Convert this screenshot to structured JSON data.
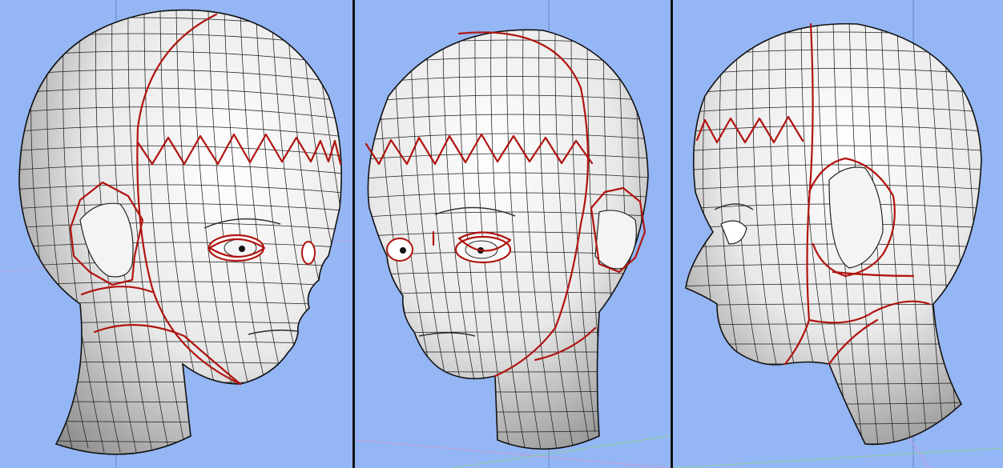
{
  "viewports": [
    {
      "id": "vp-left",
      "view": "three-quarter-left"
    },
    {
      "id": "vp-mid",
      "view": "three-quarter-right"
    },
    {
      "id": "vp-right",
      "view": "side-profile"
    }
  ],
  "colors": {
    "viewport_background": "#94b6f4",
    "uv_seam": "#b0140f",
    "wireframe": "#1e1e1e",
    "grid_axis_x": "#c79bd4",
    "grid_axis_y": "#8fd0a0",
    "grid_axis_z": "#5f86c9",
    "divider": "#111111"
  }
}
